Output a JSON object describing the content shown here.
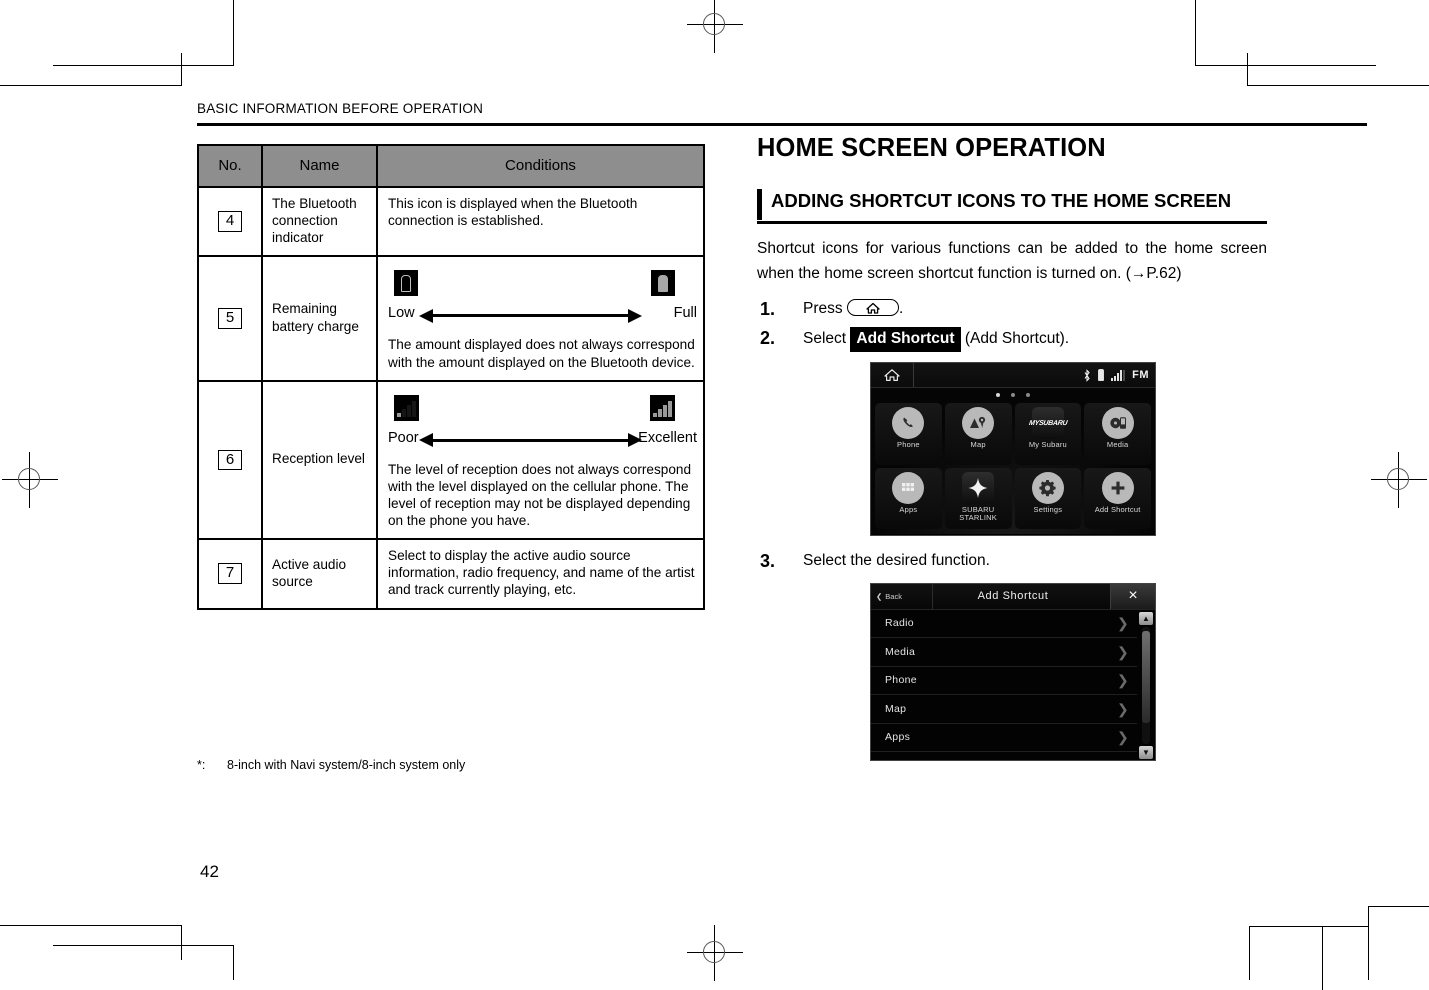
{
  "running_head": "BASIC INFORMATION BEFORE OPERATION",
  "page_number": "42",
  "table": {
    "headers": [
      "No.",
      "Name",
      "Conditions"
    ],
    "rows": [
      {
        "no": "4",
        "name": "The Bluetooth connection indicator",
        "conditions": "This icon is displayed when the Bluetooth connection is established."
      },
      {
        "no": "5",
        "name": "Remaining battery charge",
        "range": {
          "left_label": "Low",
          "right_label": "Full"
        },
        "conditions": "The amount displayed does not always correspond with the amount displayed on the Bluetooth device."
      },
      {
        "no": "6",
        "name": "Reception level",
        "range": {
          "left_label": "Poor",
          "right_label": "Excellent"
        },
        "conditions": "The level of reception does not always correspond with the level displayed on the cellular phone. The level of reception may not be displayed depending on the phone you have."
      },
      {
        "no": "7",
        "name": "Active audio source",
        "conditions": "Select to display the active audio source information, radio frequency, and name of the artist and track currently playing, etc."
      }
    ]
  },
  "footnote": {
    "marker": "*:",
    "text": "8-inch with Navi system/8-inch system only"
  },
  "section": {
    "title": "HOME SCREEN OPERATION",
    "subtitle": "ADDING SHORTCUT ICONS TO THE HOME SCREEN",
    "intro": "Shortcut icons for various functions can be added to the home screen when the home screen shortcut function is turned on. (→P.62)",
    "steps": [
      {
        "num": "1.",
        "before": "Press",
        "after": "."
      },
      {
        "num": "2.",
        "before": "Select",
        "key": "Add Shortcut",
        "after": "(Add Shortcut)."
      },
      {
        "num": "3.",
        "before": "Select the desired function.",
        "after": ""
      }
    ]
  },
  "home_screen": {
    "status": {
      "fm_label": "FM"
    },
    "tiles": [
      {
        "label": "Phone",
        "icon": "phone-icon"
      },
      {
        "label": "Map",
        "icon": "map-icon"
      },
      {
        "label": "My Subaru",
        "icon": "my-subaru-icon",
        "logo_text": "MYSUBARU"
      },
      {
        "label": "Media",
        "icon": "media-icon"
      },
      {
        "label": "Apps",
        "icon": "apps-grid-icon"
      },
      {
        "label": "SUBARU STARLINK",
        "icon": "starlink-icon"
      },
      {
        "label": "Settings",
        "icon": "gear-icon"
      },
      {
        "label": "Add Shortcut",
        "icon": "plus-icon"
      }
    ]
  },
  "list_screen": {
    "back_label": "Back",
    "title": "Add Shortcut",
    "close_label": "×",
    "items": [
      "Radio",
      "Media",
      "Phone",
      "Map",
      "Apps"
    ]
  }
}
